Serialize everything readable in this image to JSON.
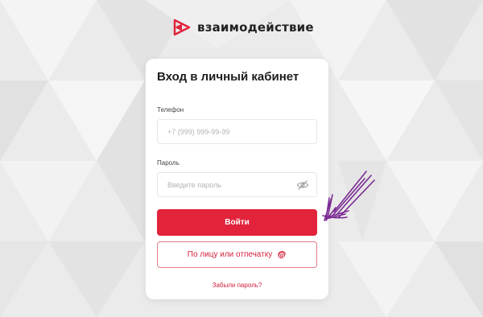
{
  "brand": {
    "name": "взаимодействие",
    "accent": "#e2233b"
  },
  "login": {
    "title": "Вход в личный кабинет",
    "phone_label": "Телефон",
    "phone_placeholder": "+7 (999) 999-99-99",
    "password_label": "Пароль",
    "password_placeholder": "Введите пароль",
    "submit_label": "Войти",
    "biometric_label": "По лицу или отпечатку",
    "forgot_label": "Забыли пароль?"
  },
  "icons": {
    "password_toggle": "eye-off-icon",
    "biometric": "fingerprint-icon",
    "logo": "logo-mark-icon"
  }
}
